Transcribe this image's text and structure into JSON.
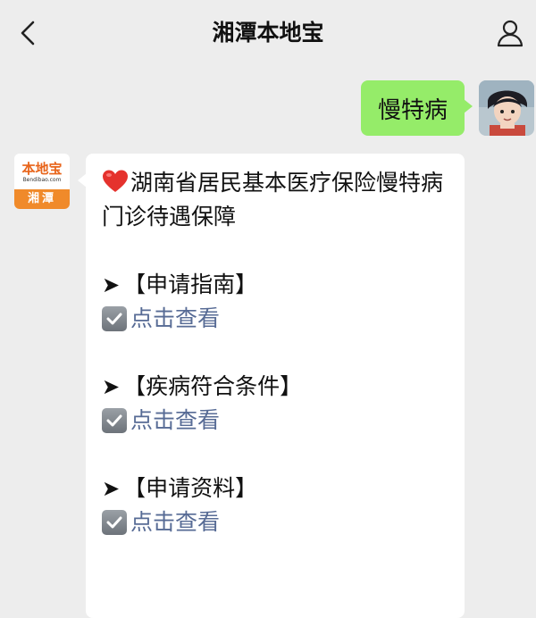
{
  "header": {
    "title": "湘潭本地宝"
  },
  "chat": {
    "outgoing": {
      "text": "慢特病"
    },
    "incoming": {
      "sender_logo": {
        "brand": "本地宝",
        "domain": "Bendibao.com",
        "city": "湘潭"
      },
      "headline": "湖南省居民基本医疗保险慢特病门诊待遇保障",
      "sections": [
        {
          "title": "【申请指南】",
          "link": "点击查看"
        },
        {
          "title": "【疾病符合条件】",
          "link": "点击查看"
        },
        {
          "title": "【申请资料】",
          "link": "点击查看"
        }
      ]
    }
  },
  "icons": {
    "back": "chevron-left-icon",
    "profile": "person-icon",
    "heart": "heart-icon",
    "check": "checkbox-icon",
    "arrow": "arrow-right-icon"
  },
  "colors": {
    "background": "#ededed",
    "outgoing_bubble": "#95ec69",
    "incoming_bubble": "#ffffff",
    "link": "#576b95",
    "brand_orange": "#f08a2a"
  }
}
